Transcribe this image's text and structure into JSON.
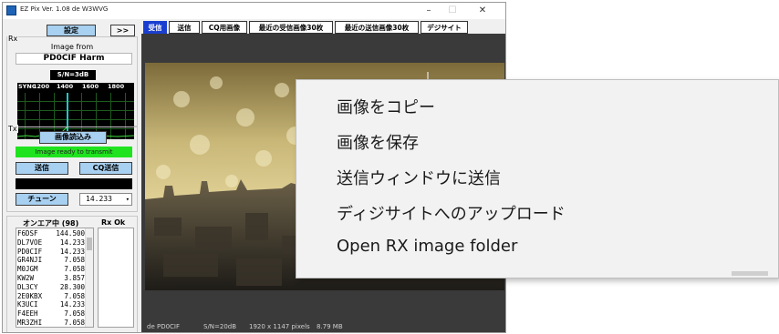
{
  "window": {
    "title": "EZ Pix   Ver. 1.08 de W3WVG",
    "minimize": "–",
    "maximize": "☐",
    "close": "✕"
  },
  "rx": {
    "group_label": "Rx",
    "settings_button": "設定",
    "expand_button": ">>",
    "image_from_label": "Image from",
    "image_from_value": "PD0CIF Harm",
    "snr": "S/N=3dB",
    "ticks": [
      "SYNC",
      "1200",
      "1400",
      "1600",
      "1800"
    ]
  },
  "tx": {
    "group_label": "Tx",
    "load_image_button": "画像読込み",
    "status": "Image ready to transmit",
    "send_button": "送信",
    "cq_send_button": "CQ送信",
    "tune_button": "チューン",
    "frequency": "14.233",
    "colors": {
      "status_bg": "#1fe31f",
      "progress_bg": "#000000"
    }
  },
  "onair": {
    "header": "オンエア中 (98)",
    "rx_ok_header": "Rx Ok",
    "stations": [
      {
        "call": "F6DSF",
        "freq": "144.500"
      },
      {
        "call": "DL7VOE",
        "freq": "14.233"
      },
      {
        "call": "PD0CIF",
        "freq": "14.233"
      },
      {
        "call": "GR4NJI",
        "freq": "7.058"
      },
      {
        "call": "M0JGM",
        "freq": "7.058"
      },
      {
        "call": "KW2W",
        "freq": "3.857"
      },
      {
        "call": "DL3CY",
        "freq": "28.300"
      },
      {
        "call": "2E0KBX",
        "freq": "7.058"
      },
      {
        "call": "K3UCI",
        "freq": "14.233"
      },
      {
        "call": "F4EEH",
        "freq": "7.058"
      },
      {
        "call": "MR3ZHI",
        "freq": "7.058"
      }
    ]
  },
  "tabs": [
    "受信",
    "送信",
    "CQ用画像",
    "最近の受信画像30枚",
    "最近の送信画像30枚",
    "デジサイト"
  ],
  "active_tab": 0,
  "image_status": {
    "from": "de PD0CIF",
    "snr": "S/N=20dB",
    "dims": "1920 x 1147 pixels",
    "size": "8.79 MB"
  },
  "context_menu": {
    "items": [
      "画像をコピー",
      "画像を保存",
      "送信ウィンドウに送信",
      "ディジサイトへのアップロード",
      "Open RX image folder"
    ]
  }
}
